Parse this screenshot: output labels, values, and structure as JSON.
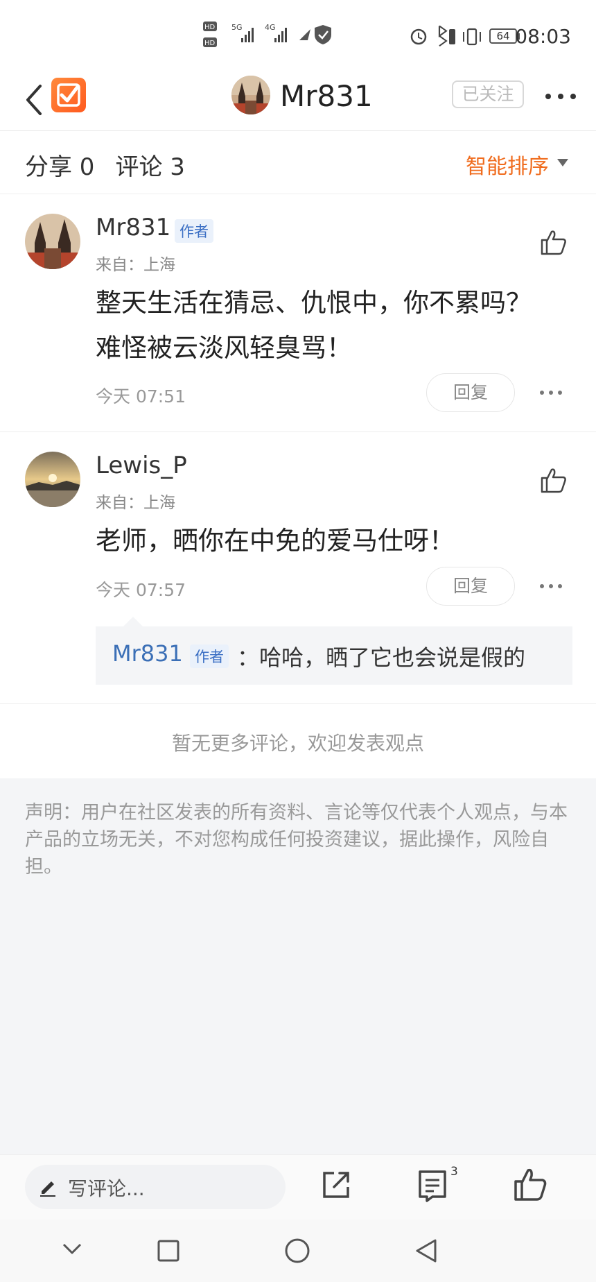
{
  "status_bar": {
    "time": "08:03",
    "battery": "64"
  },
  "header": {
    "user_name": "Mr831",
    "follow_label": "已关注"
  },
  "stats": {
    "shares_label": "分享 0",
    "comments_label": "评论 3",
    "sort_label": "智能排序"
  },
  "comments": [
    {
      "name": "Mr831",
      "tag": "作者",
      "from": "来自：上海",
      "lines": [
        "整天生活在猜忌、仇恨中，你不累吗？",
        "难怪被云淡风轻臭骂！"
      ],
      "time": "今天 07:51",
      "reply_label": "回复"
    },
    {
      "name": "Lewis_P",
      "from": "来自：上海",
      "lines": [
        "老师，晒你在中免的爱马仕呀！"
      ],
      "time": "今天 07:57",
      "reply_label": "回复",
      "sub_reply": {
        "name": "Mr831",
        "tag": "作者",
        "text": "：哈哈，晒了它也会说是假的"
      }
    }
  ],
  "no_more": "暂无更多评论，欢迎发表观点",
  "disclaimer": "声明：用户在社区发表的所有资料、言论等仅代表个人观点，与本产品的立场无关，不对您构成任何投资建议，据此操作，风险自担。",
  "action_bar": {
    "write_placeholder": "写评论...",
    "comment_count": "3"
  },
  "colors": {
    "accent_orange": "#f06c1e",
    "link_blue": "#3b6fb6"
  }
}
